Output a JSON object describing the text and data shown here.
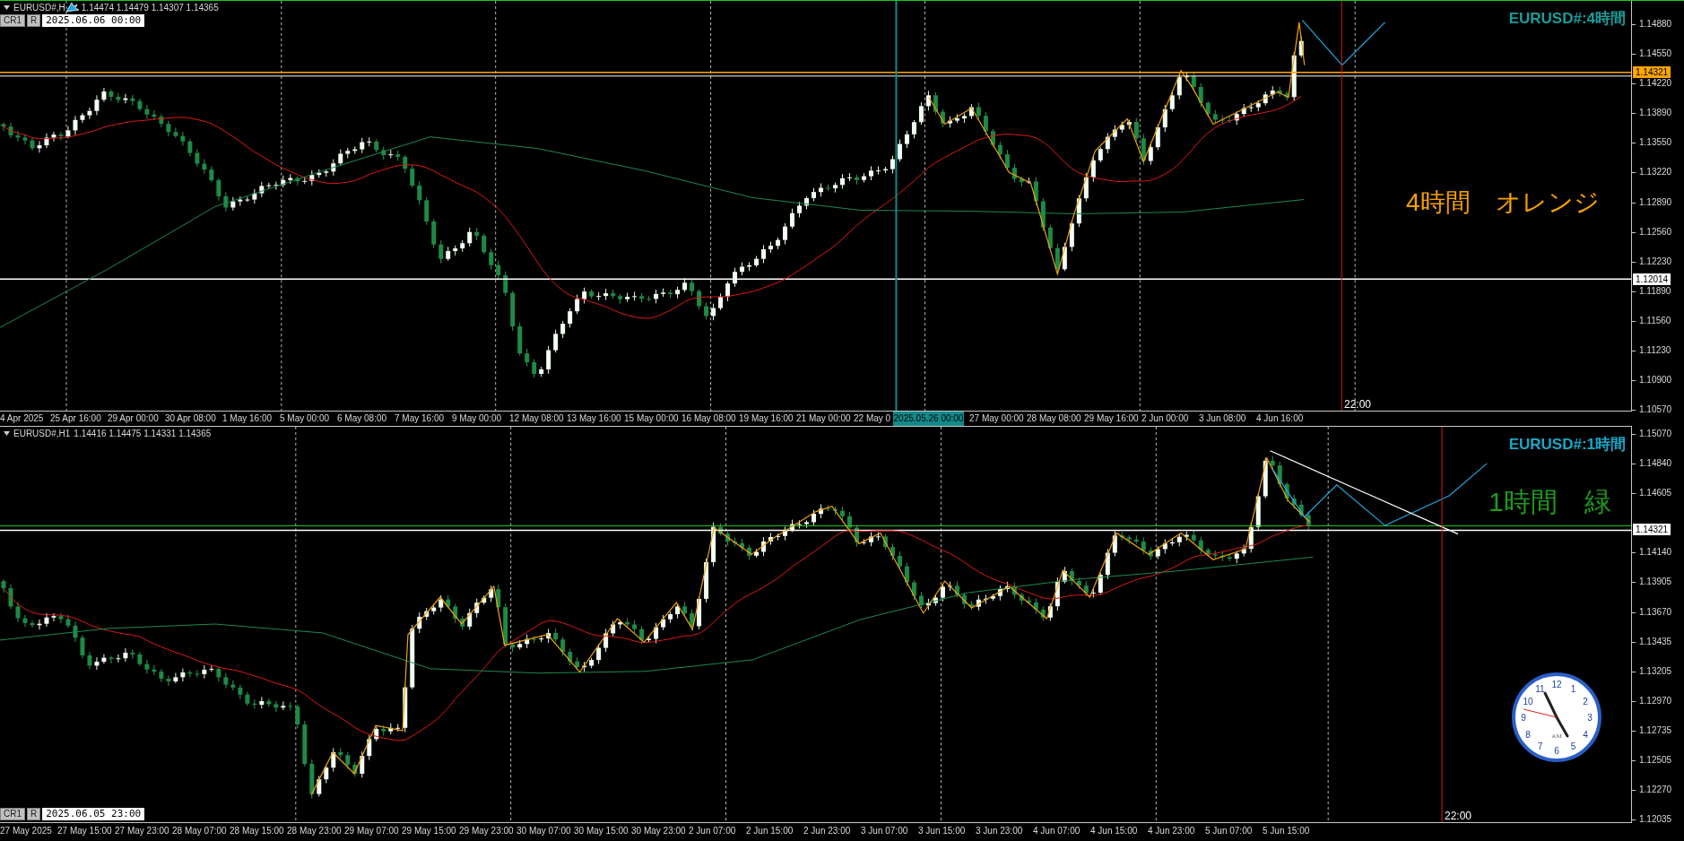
{
  "panels": [
    {
      "header": {
        "symbol": "EURUSD#,H",
        "quotes": "1.14474 1.14479 1.14307 1.14365"
      },
      "date_box": {
        "buttons": [
          "CR1",
          "R"
        ],
        "value": "2025.06.06 00:00"
      },
      "title": "EURUSD#:4時間",
      "note": "4時間　オレンジ",
      "price_ticks": [
        "1.14880",
        "1.14550",
        "1.14220",
        "1.13890",
        "1.13550",
        "1.13220",
        "1.12890",
        "1.12560",
        "1.12230",
        "1.11890",
        "1.11560",
        "1.11230",
        "1.10900",
        "1.10570"
      ],
      "price_lines": [
        {
          "label": "1.14321",
          "color": "#ffa500"
        },
        {
          "label": "1.12014",
          "color": "#ffffff"
        }
      ],
      "time_labels": [
        {
          "text": "4 Apr 2025",
          "kind": "tick"
        },
        {
          "text": "25 Apr 16:00",
          "kind": "tick"
        },
        {
          "text": "29 Apr 00:00",
          "kind": "tick"
        },
        {
          "text": "30 Apr 08:00",
          "kind": "tick"
        },
        {
          "text": "1 May 16:00",
          "kind": "tick"
        },
        {
          "text": "5 May 00:00",
          "kind": "tick"
        },
        {
          "text": "6 May 08:00",
          "kind": "tick"
        },
        {
          "text": "7 May 16:00",
          "kind": "tick"
        },
        {
          "text": "9 May 00:00",
          "kind": "tick"
        },
        {
          "text": "12 May 08:00",
          "kind": "tick"
        },
        {
          "text": "13 May 16:00",
          "kind": "tick"
        },
        {
          "text": "15 May 00:00",
          "kind": "tick"
        },
        {
          "text": "16 May 08:00",
          "kind": "tick"
        },
        {
          "text": "19 May 16:00",
          "kind": "tick"
        },
        {
          "text": "21 May 00:00",
          "kind": "tick"
        },
        {
          "text": "22 May 0",
          "kind": "tick"
        },
        {
          "text": "2025.05.26 00:00",
          "kind": "crosshair"
        },
        {
          "text": "27 May 00:00",
          "kind": "tick"
        },
        {
          "text": "28 May 08:00",
          "kind": "tick"
        },
        {
          "text": "29 May 16:00",
          "kind": "tick"
        },
        {
          "text": "2 Jun 00:00",
          "kind": "tick"
        },
        {
          "text": "3 Jun 08:00",
          "kind": "tick"
        },
        {
          "text": "4 Jun 16:00",
          "kind": "tick"
        }
      ],
      "marker_time": "22:00"
    },
    {
      "header": {
        "symbol": "EURUSD#,H1",
        "quotes": "1.14416 1.14475 1.14331 1.14365"
      },
      "date_box": {
        "buttons": [
          "CR1",
          "R"
        ],
        "value": "2025.06.05 23:00"
      },
      "title": "EURUSD#:1時間",
      "note": "1時間　緑",
      "price_ticks": [
        "1.15070",
        "1.14840",
        "1.14605",
        "1.14140",
        "1.13905",
        "1.13670",
        "1.13435",
        "1.13205",
        "1.12970",
        "1.12735",
        "1.12505",
        "1.12270",
        "1.12035"
      ],
      "price_lines": [
        {
          "label": "1.14321",
          "color": "#ffffff"
        }
      ],
      "time_labels": [
        {
          "text": "27 May 2025",
          "kind": "tick"
        },
        {
          "text": "27 May 15:00",
          "kind": "tick"
        },
        {
          "text": "27 May 23:00",
          "kind": "tick"
        },
        {
          "text": "28 May 07:00",
          "kind": "tick"
        },
        {
          "text": "28 May 15:00",
          "kind": "tick"
        },
        {
          "text": "28 May 23:00",
          "kind": "tick"
        },
        {
          "text": "29 May 07:00",
          "kind": "tick"
        },
        {
          "text": "29 May 15:00",
          "kind": "tick"
        },
        {
          "text": "29 May 23:00",
          "kind": "tick"
        },
        {
          "text": "30 May 07:00",
          "kind": "tick"
        },
        {
          "text": "30 May 15:00",
          "kind": "tick"
        },
        {
          "text": "30 May 23:00",
          "kind": "tick"
        },
        {
          "text": "2 Jun 07:00",
          "kind": "tick"
        },
        {
          "text": "2 Jun 15:00",
          "kind": "tick"
        },
        {
          "text": "2 Jun 23:00",
          "kind": "tick"
        },
        {
          "text": "3 Jun 07:00",
          "kind": "tick"
        },
        {
          "text": "3 Jun 15:00",
          "kind": "tick"
        },
        {
          "text": "3 Jun 23:00",
          "kind": "tick"
        },
        {
          "text": "4 Jun 07:00",
          "kind": "tick"
        },
        {
          "text": "4 Jun 15:00",
          "kind": "tick"
        },
        {
          "text": "4 Jun 23:00",
          "kind": "tick"
        },
        {
          "text": "5 Jun 07:00",
          "kind": "tick"
        },
        {
          "text": "5 Jun 15:00",
          "kind": "tick"
        }
      ],
      "marker_time": "22:00",
      "clock": {
        "numbers": [
          "12",
          "1",
          "2",
          "3",
          "4",
          "5",
          "6",
          "7",
          "8",
          "9",
          "10",
          "11"
        ],
        "label": "AM"
      }
    }
  ]
}
